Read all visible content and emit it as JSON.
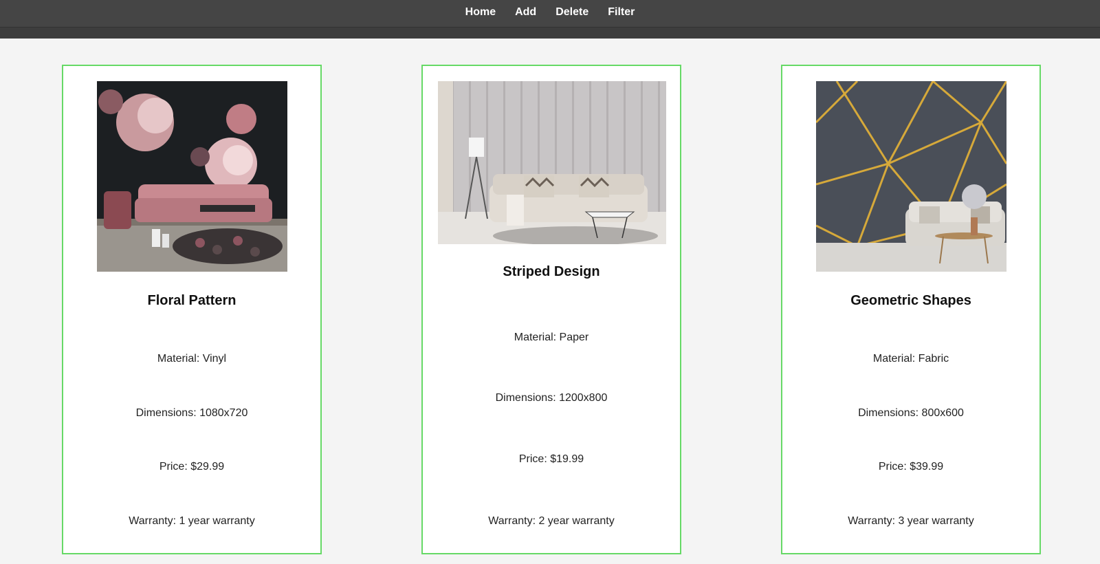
{
  "nav": {
    "items": [
      {
        "label": "Home"
      },
      {
        "label": "Add"
      },
      {
        "label": "Delete"
      },
      {
        "label": "Filter"
      }
    ]
  },
  "cards": [
    {
      "image_icon": "floral-wallpaper-room-image",
      "title": "Floral Pattern",
      "material": "Material: Vinyl",
      "dimensions": "Dimensions: 1080x720",
      "price": "Price: $29.99",
      "warranty": "Warranty: 1 year warranty"
    },
    {
      "image_icon": "striped-wallpaper-room-image",
      "title": "Striped Design",
      "material": "Material: Paper",
      "dimensions": "Dimensions: 1200x800",
      "price": "Price: $19.99",
      "warranty": "Warranty: 2 year warranty"
    },
    {
      "image_icon": "geometric-wallpaper-room-image",
      "title": "Geometric Shapes",
      "material": "Material: Fabric",
      "dimensions": "Dimensions: 800x600",
      "price": "Price: $39.99",
      "warranty": "Warranty: 3 year warranty"
    }
  ],
  "colors": {
    "nav_bg": "#3d3d3d",
    "card_border": "#66d966",
    "page_bg": "#f4f4f4"
  }
}
